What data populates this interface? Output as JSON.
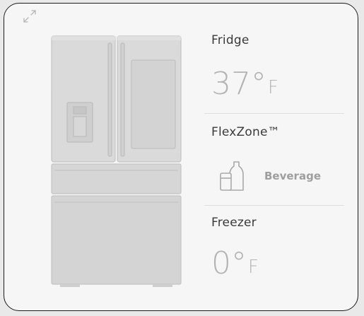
{
  "fridge": {
    "label": "Fridge",
    "temp_value": "37°",
    "temp_unit": "F"
  },
  "flexzone": {
    "label": "FlexZone™",
    "mode": "Beverage"
  },
  "freezer": {
    "label": "Freezer",
    "temp_value": "0°",
    "temp_unit": "F"
  },
  "icons": {
    "expand": "expand-icon",
    "appliance": "refrigerator-illustration",
    "mode": "beverage-icon"
  },
  "colors": {
    "card_bg": "#f6f6f6",
    "temp_text": "#b3b3b3",
    "label_text": "#3a3a3a",
    "border": "#1c1c1c"
  }
}
